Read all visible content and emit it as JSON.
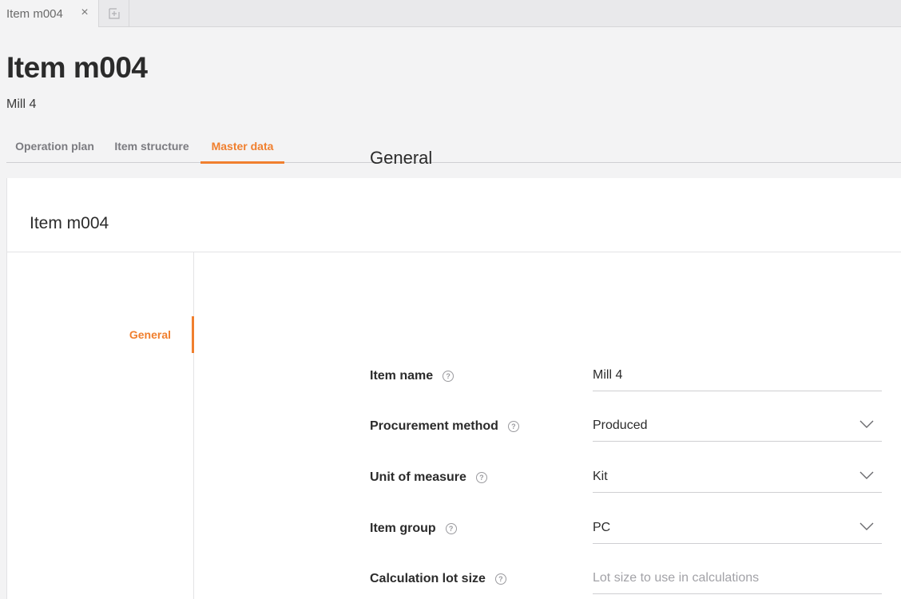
{
  "tabs": {
    "doc_tab_label": "Item m004",
    "close_glyph": "×",
    "new_tab_icon": "add-tab-icon"
  },
  "header": {
    "title": "Item m004",
    "subtitle": "Mill 4"
  },
  "section_tabs": [
    {
      "label": "Operation plan",
      "active": false
    },
    {
      "label": "Item structure",
      "active": false
    },
    {
      "label": "Master data",
      "active": true
    }
  ],
  "card": {
    "title": "Item m004",
    "side_nav": [
      {
        "label": "General",
        "active": true
      }
    ]
  },
  "form": {
    "section_title": "General",
    "help_glyph": "?",
    "fields": [
      {
        "label": "Item name",
        "value": "Mill 4",
        "type": "text"
      },
      {
        "label": "Procurement method",
        "value": "Produced",
        "type": "select"
      },
      {
        "label": "Unit of measure",
        "value": "Kit",
        "type": "select"
      },
      {
        "label": "Item group",
        "value": "PC",
        "type": "select"
      },
      {
        "label": "Calculation lot size",
        "value": "",
        "placeholder": "Lot size to use in calculations",
        "type": "text"
      }
    ]
  },
  "colors": {
    "accent": "#f07f2e",
    "text": "#2b2b2b",
    "muted": "#7b7b80",
    "background": "#f3f3f4",
    "card": "#ffffff"
  }
}
